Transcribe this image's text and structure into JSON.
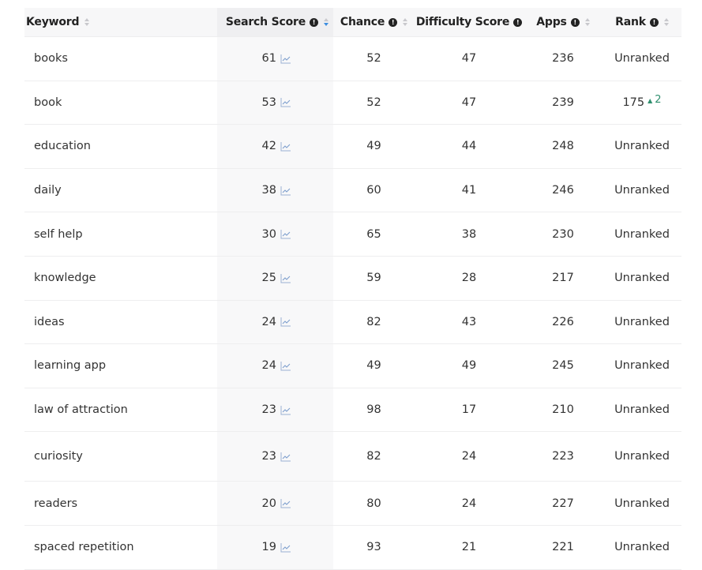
{
  "table": {
    "columns": [
      {
        "key": "keyword",
        "label": "Keyword",
        "info": false,
        "sort": "none"
      },
      {
        "key": "search_score",
        "label": "Search Score",
        "info": true,
        "sort": "desc"
      },
      {
        "key": "chance",
        "label": "Chance",
        "info": true,
        "sort": "none"
      },
      {
        "key": "difficulty",
        "label": "Difficulty Score",
        "info": true,
        "sort": "hidden"
      },
      {
        "key": "apps",
        "label": "Apps",
        "info": true,
        "sort": "none"
      },
      {
        "key": "rank",
        "label": "Rank",
        "info": true,
        "sort": "none"
      }
    ],
    "rows": [
      {
        "keyword": "books",
        "search_score": "61",
        "chance": "52",
        "difficulty": "47",
        "apps": "236",
        "rank": "Unranked",
        "rank_change": ""
      },
      {
        "keyword": "book",
        "search_score": "53",
        "chance": "52",
        "difficulty": "47",
        "apps": "239",
        "rank": "175",
        "rank_change": "2"
      },
      {
        "keyword": "education",
        "search_score": "42",
        "chance": "49",
        "difficulty": "44",
        "apps": "248",
        "rank": "Unranked",
        "rank_change": ""
      },
      {
        "keyword": "daily",
        "search_score": "38",
        "chance": "60",
        "difficulty": "41",
        "apps": "246",
        "rank": "Unranked",
        "rank_change": ""
      },
      {
        "keyword": "self help",
        "search_score": "30",
        "chance": "65",
        "difficulty": "38",
        "apps": "230",
        "rank": "Unranked",
        "rank_change": ""
      },
      {
        "keyword": "knowledge",
        "search_score": "25",
        "chance": "59",
        "difficulty": "28",
        "apps": "217",
        "rank": "Unranked",
        "rank_change": ""
      },
      {
        "keyword": "ideas",
        "search_score": "24",
        "chance": "82",
        "difficulty": "43",
        "apps": "226",
        "rank": "Unranked",
        "rank_change": ""
      },
      {
        "keyword": "learning app",
        "search_score": "24",
        "chance": "49",
        "difficulty": "49",
        "apps": "245",
        "rank": "Unranked",
        "rank_change": ""
      },
      {
        "keyword": "law of attraction",
        "search_score": "23",
        "chance": "98",
        "difficulty": "17",
        "apps": "210",
        "rank": "Unranked",
        "rank_change": ""
      },
      {
        "keyword": "curiosity",
        "search_score": "23",
        "chance": "82",
        "difficulty": "24",
        "apps": "223",
        "rank": "Unranked",
        "rank_change": ""
      },
      {
        "keyword": "readers",
        "search_score": "20",
        "chance": "80",
        "difficulty": "24",
        "apps": "227",
        "rank": "Unranked",
        "rank_change": ""
      },
      {
        "keyword": "spaced repetition",
        "search_score": "19",
        "chance": "93",
        "difficulty": "21",
        "apps": "221",
        "rank": "Unranked",
        "rank_change": ""
      }
    ]
  },
  "icons": {
    "info": "info-icon",
    "sort": "sort-icon",
    "trend": "trend-chart-icon",
    "rank_up": "triangle-up-icon"
  },
  "colors": {
    "rank_up": "#2f8f6e",
    "sort_active": "#3b8de0",
    "trend_icon": "#7a9ccc",
    "header_bg": "#f7f7f8",
    "search_col_bg": "#f8f8f9"
  }
}
